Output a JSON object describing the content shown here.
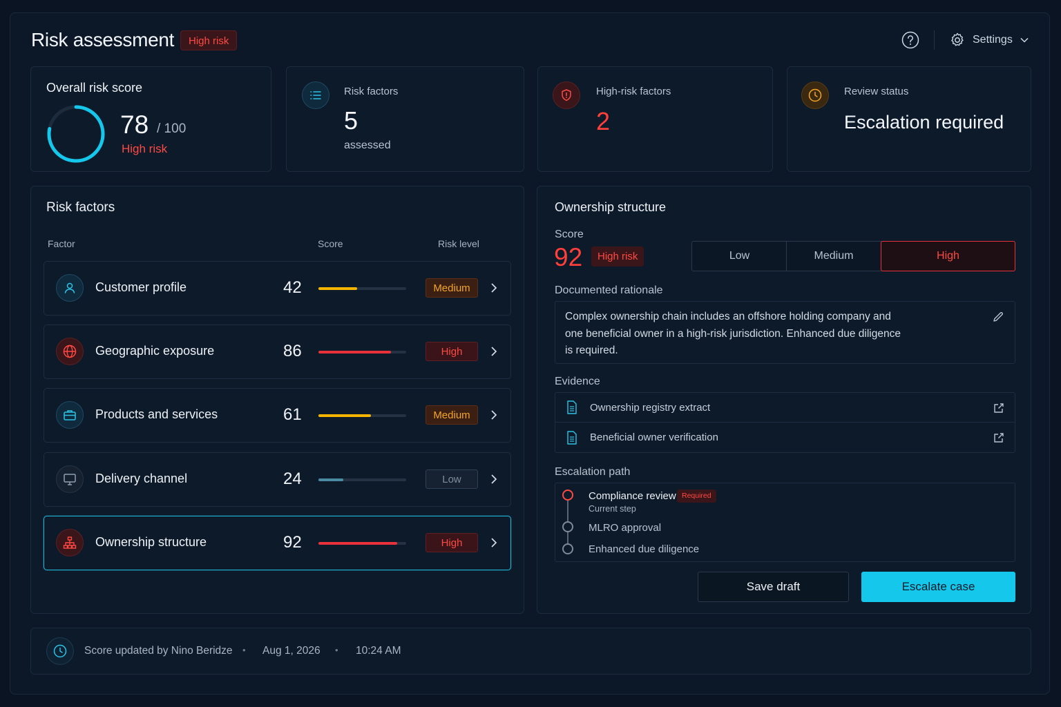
{
  "header": {
    "title": "Risk assessment",
    "badge": "High risk",
    "settings_label": "Settings"
  },
  "summary": {
    "overall": {
      "label": "Overall risk score",
      "score": "78",
      "max": "/ 100",
      "level": "High risk",
      "fraction": 0.78
    },
    "factors": {
      "label": "Risk factors",
      "value": "5",
      "sub": "assessed"
    },
    "high_risk": {
      "label": "High-risk factors",
      "value": "2"
    },
    "review": {
      "label": "Review status",
      "value": "Escalation required"
    }
  },
  "risk_factors": {
    "title": "Risk factors",
    "columns": [
      "Factor",
      "Score",
      "Risk level"
    ],
    "rows": [
      {
        "name": "Customer profile",
        "score": "42",
        "level": "Medium",
        "fraction": 0.44,
        "color": "#f5b400",
        "icon": "user-icon"
      },
      {
        "name": "Geographic exposure",
        "score": "86",
        "level": "High",
        "fraction": 0.83,
        "color": "#e8313a",
        "icon": "globe-icon"
      },
      {
        "name": "Products and services",
        "score": "61",
        "level": "Medium",
        "fraction": 0.6,
        "color": "#f5b400",
        "icon": "briefcase-icon"
      },
      {
        "name": "Delivery channel",
        "score": "24",
        "level": "Low",
        "fraction": 0.28,
        "color": "#4b8aa3",
        "icon": "monitor-icon"
      },
      {
        "name": "Ownership structure",
        "score": "92",
        "level": "High",
        "fraction": 0.9,
        "color": "#e8313a",
        "icon": "org-chart-icon"
      }
    ]
  },
  "ownership": {
    "title": "Ownership structure",
    "score_label": "Score",
    "score": "92",
    "badge": "High risk",
    "segments": [
      "Low",
      "Medium",
      "High"
    ],
    "selected_segment": "High",
    "rationale_label": "Documented rationale",
    "rationale_lines": [
      "Complex ownership chain includes an offshore holding company and",
      "one beneficial owner in a high-risk jurisdiction. Enhanced due diligence",
      "is required."
    ],
    "evidence_label": "Evidence",
    "evidence": [
      "Ownership registry extract",
      "Beneficial owner verification"
    ],
    "escalation_label": "Escalation path",
    "escalation": {
      "current": {
        "name": "Compliance review",
        "badge": "Required",
        "sub": "Current step"
      },
      "next": [
        "MLRO approval",
        "Enhanced due diligence"
      ]
    },
    "save_label": "Save draft",
    "escalate_label": "Escalate case"
  },
  "footer": {
    "updated_by": "Score updated by Nino Beridze",
    "sep": "•",
    "date": "Aug 1, 2026",
    "time": "10:24 AM"
  },
  "colors": {
    "accent": "#16c7ec",
    "danger": "#ff4a43",
    "warning": "#f5a623",
    "background": "#0a1422"
  }
}
